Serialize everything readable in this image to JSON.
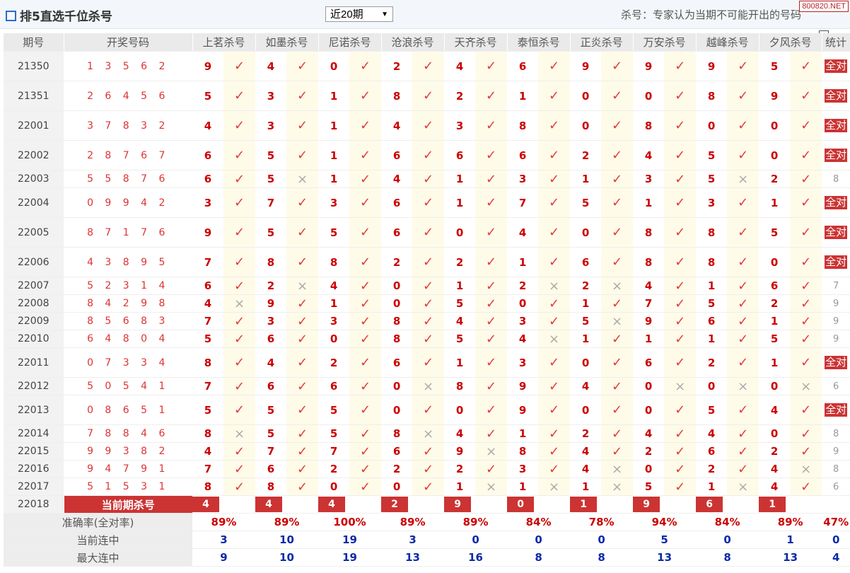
{
  "header": {
    "title": "排5直选千位杀号",
    "period_select": "近20期",
    "note": "杀号：专家认为当期不可能开出的号码",
    "brand": "800820.NET"
  },
  "columns": {
    "issue": "期号",
    "draw": "开奖号码",
    "experts": [
      "上茗杀号",
      "如墨杀号",
      "尼诺杀号",
      "沧浪杀号",
      "天齐杀号",
      "泰恒杀号",
      "正炎杀号",
      "万安杀号",
      "越峰杀号",
      "夕风杀号"
    ],
    "stat": "统计"
  },
  "marks": {
    "ok": "✓",
    "no": "×"
  },
  "all_right_label": "全对",
  "rows": [
    {
      "issue": "21350",
      "draw": "1 3 5 6 2",
      "kills": [
        [
          "9",
          1
        ],
        [
          "4",
          1
        ],
        [
          "0",
          1
        ],
        [
          "2",
          1
        ],
        [
          "4",
          1
        ],
        [
          "6",
          1
        ],
        [
          "9",
          1
        ],
        [
          "9",
          1
        ],
        [
          "9",
          1
        ],
        [
          "5",
          1
        ]
      ],
      "stat": "全对"
    },
    {
      "issue": "21351",
      "draw": "2 6 4 5 6",
      "kills": [
        [
          "5",
          1
        ],
        [
          "3",
          1
        ],
        [
          "1",
          1
        ],
        [
          "8",
          1
        ],
        [
          "2",
          1
        ],
        [
          "1",
          1
        ],
        [
          "0",
          1
        ],
        [
          "0",
          1
        ],
        [
          "8",
          1
        ],
        [
          "9",
          1
        ]
      ],
      "stat": "全对"
    },
    {
      "issue": "22001",
      "draw": "3 7 8 3 2",
      "kills": [
        [
          "4",
          1
        ],
        [
          "3",
          1
        ],
        [
          "1",
          1
        ],
        [
          "4",
          1
        ],
        [
          "3",
          1
        ],
        [
          "8",
          1
        ],
        [
          "0",
          1
        ],
        [
          "8",
          1
        ],
        [
          "0",
          1
        ],
        [
          "0",
          1
        ]
      ],
      "stat": "全对"
    },
    {
      "issue": "22002",
      "draw": "2 8 7 6 7",
      "kills": [
        [
          "6",
          1
        ],
        [
          "5",
          1
        ],
        [
          "1",
          1
        ],
        [
          "6",
          1
        ],
        [
          "6",
          1
        ],
        [
          "6",
          1
        ],
        [
          "2",
          1
        ],
        [
          "4",
          1
        ],
        [
          "5",
          1
        ],
        [
          "0",
          1
        ]
      ],
      "stat": "全对"
    },
    {
      "issue": "22003",
      "draw": "5 5 8 7 6",
      "kills": [
        [
          "6",
          1
        ],
        [
          "5",
          0
        ],
        [
          "1",
          1
        ],
        [
          "4",
          1
        ],
        [
          "1",
          1
        ],
        [
          "3",
          1
        ],
        [
          "1",
          1
        ],
        [
          "3",
          1
        ],
        [
          "5",
          0
        ],
        [
          "2",
          1
        ]
      ],
      "stat": "8"
    },
    {
      "issue": "22004",
      "draw": "0 9 9 4 2",
      "kills": [
        [
          "3",
          1
        ],
        [
          "7",
          1
        ],
        [
          "3",
          1
        ],
        [
          "6",
          1
        ],
        [
          "1",
          1
        ],
        [
          "7",
          1
        ],
        [
          "5",
          1
        ],
        [
          "1",
          1
        ],
        [
          "3",
          1
        ],
        [
          "1",
          1
        ]
      ],
      "stat": "全对"
    },
    {
      "issue": "22005",
      "draw": "8 7 1 7 6",
      "kills": [
        [
          "9",
          1
        ],
        [
          "5",
          1
        ],
        [
          "5",
          1
        ],
        [
          "6",
          1
        ],
        [
          "0",
          1
        ],
        [
          "4",
          1
        ],
        [
          "0",
          1
        ],
        [
          "8",
          1
        ],
        [
          "8",
          1
        ],
        [
          "5",
          1
        ]
      ],
      "stat": "全对"
    },
    {
      "issue": "22006",
      "draw": "4 3 8 9 5",
      "kills": [
        [
          "7",
          1
        ],
        [
          "8",
          1
        ],
        [
          "8",
          1
        ],
        [
          "2",
          1
        ],
        [
          "2",
          1
        ],
        [
          "1",
          1
        ],
        [
          "6",
          1
        ],
        [
          "8",
          1
        ],
        [
          "8",
          1
        ],
        [
          "0",
          1
        ]
      ],
      "stat": "全对"
    },
    {
      "issue": "22007",
      "draw": "5 2 3 1 4",
      "kills": [
        [
          "6",
          1
        ],
        [
          "2",
          0
        ],
        [
          "4",
          1
        ],
        [
          "0",
          1
        ],
        [
          "1",
          1
        ],
        [
          "2",
          0
        ],
        [
          "2",
          0
        ],
        [
          "4",
          1
        ],
        [
          "1",
          1
        ],
        [
          "6",
          1
        ]
      ],
      "stat": "7"
    },
    {
      "issue": "22008",
      "draw": "8 4 2 9 8",
      "kills": [
        [
          "4",
          0
        ],
        [
          "9",
          1
        ],
        [
          "1",
          1
        ],
        [
          "0",
          1
        ],
        [
          "5",
          1
        ],
        [
          "0",
          1
        ],
        [
          "1",
          1
        ],
        [
          "7",
          1
        ],
        [
          "5",
          1
        ],
        [
          "2",
          1
        ]
      ],
      "stat": "9"
    },
    {
      "issue": "22009",
      "draw": "8 5 6 8 3",
      "kills": [
        [
          "7",
          1
        ],
        [
          "3",
          1
        ],
        [
          "3",
          1
        ],
        [
          "8",
          1
        ],
        [
          "4",
          1
        ],
        [
          "3",
          1
        ],
        [
          "5",
          0
        ],
        [
          "9",
          1
        ],
        [
          "6",
          1
        ],
        [
          "1",
          1
        ]
      ],
      "stat": "9"
    },
    {
      "issue": "22010",
      "draw": "6 4 8 0 4",
      "kills": [
        [
          "5",
          1
        ],
        [
          "6",
          1
        ],
        [
          "0",
          1
        ],
        [
          "8",
          1
        ],
        [
          "5",
          1
        ],
        [
          "4",
          0
        ],
        [
          "1",
          1
        ],
        [
          "1",
          1
        ],
        [
          "1",
          1
        ],
        [
          "5",
          1
        ]
      ],
      "stat": "9"
    },
    {
      "issue": "22011",
      "draw": "0 7 3 3 4",
      "kills": [
        [
          "8",
          1
        ],
        [
          "4",
          1
        ],
        [
          "2",
          1
        ],
        [
          "6",
          1
        ],
        [
          "1",
          1
        ],
        [
          "3",
          1
        ],
        [
          "0",
          1
        ],
        [
          "6",
          1
        ],
        [
          "2",
          1
        ],
        [
          "1",
          1
        ]
      ],
      "stat": "全对"
    },
    {
      "issue": "22012",
      "draw": "5 0 5 4 1",
      "kills": [
        [
          "7",
          1
        ],
        [
          "6",
          1
        ],
        [
          "6",
          1
        ],
        [
          "0",
          0
        ],
        [
          "8",
          1
        ],
        [
          "9",
          1
        ],
        [
          "4",
          1
        ],
        [
          "0",
          0
        ],
        [
          "0",
          0
        ],
        [
          "0",
          0
        ]
      ],
      "stat": "6"
    },
    {
      "issue": "22013",
      "draw": "0 8 6 5 1",
      "kills": [
        [
          "5",
          1
        ],
        [
          "5",
          1
        ],
        [
          "5",
          1
        ],
        [
          "0",
          1
        ],
        [
          "0",
          1
        ],
        [
          "9",
          1
        ],
        [
          "0",
          1
        ],
        [
          "0",
          1
        ],
        [
          "5",
          1
        ],
        [
          "4",
          1
        ]
      ],
      "stat": "全对"
    },
    {
      "issue": "22014",
      "draw": "7 8 8 4 6",
      "kills": [
        [
          "8",
          0
        ],
        [
          "5",
          1
        ],
        [
          "5",
          1
        ],
        [
          "8",
          0
        ],
        [
          "4",
          1
        ],
        [
          "1",
          1
        ],
        [
          "2",
          1
        ],
        [
          "4",
          1
        ],
        [
          "4",
          1
        ],
        [
          "0",
          1
        ]
      ],
      "stat": "8"
    },
    {
      "issue": "22015",
      "draw": "9 9 3 8 2",
      "kills": [
        [
          "4",
          1
        ],
        [
          "7",
          1
        ],
        [
          "7",
          1
        ],
        [
          "6",
          1
        ],
        [
          "9",
          0
        ],
        [
          "8",
          1
        ],
        [
          "4",
          1
        ],
        [
          "2",
          1
        ],
        [
          "6",
          1
        ],
        [
          "2",
          1
        ]
      ],
      "stat": "9"
    },
    {
      "issue": "22016",
      "draw": "9 4 7 9 1",
      "kills": [
        [
          "7",
          1
        ],
        [
          "6",
          1
        ],
        [
          "2",
          1
        ],
        [
          "2",
          1
        ],
        [
          "2",
          1
        ],
        [
          "3",
          1
        ],
        [
          "4",
          0
        ],
        [
          "0",
          1
        ],
        [
          "2",
          1
        ],
        [
          "4",
          0
        ]
      ],
      "stat": "8"
    },
    {
      "issue": "22017",
      "draw": "5 1 5 3 1",
      "kills": [
        [
          "8",
          1
        ],
        [
          "8",
          1
        ],
        [
          "0",
          1
        ],
        [
          "0",
          1
        ],
        [
          "1",
          0
        ],
        [
          "1",
          0
        ],
        [
          "1",
          0
        ],
        [
          "5",
          1
        ],
        [
          "1",
          0
        ],
        [
          "4",
          1
        ]
      ],
      "stat": "6"
    }
  ],
  "current": {
    "issue": "22018",
    "label": "当前期杀号",
    "kills": [
      "4",
      "4",
      "4",
      "2",
      "9",
      "0",
      "1",
      "9",
      "6",
      "1"
    ]
  },
  "summary": [
    {
      "label": "准确率(全对率)",
      "values": [
        "89%",
        "89%",
        "100%",
        "89%",
        "89%",
        "84%",
        "78%",
        "94%",
        "84%",
        "89%",
        "47%"
      ],
      "cls": "pct"
    },
    {
      "label": "当前连中",
      "values": [
        "3",
        "10",
        "19",
        "3",
        "0",
        "0",
        "0",
        "5",
        "0",
        "1",
        "0"
      ],
      "cls": "blu"
    },
    {
      "label": "最大连中",
      "values": [
        "9",
        "10",
        "19",
        "13",
        "16",
        "8",
        "8",
        "13",
        "8",
        "13",
        "4"
      ],
      "cls": "blu"
    }
  ]
}
